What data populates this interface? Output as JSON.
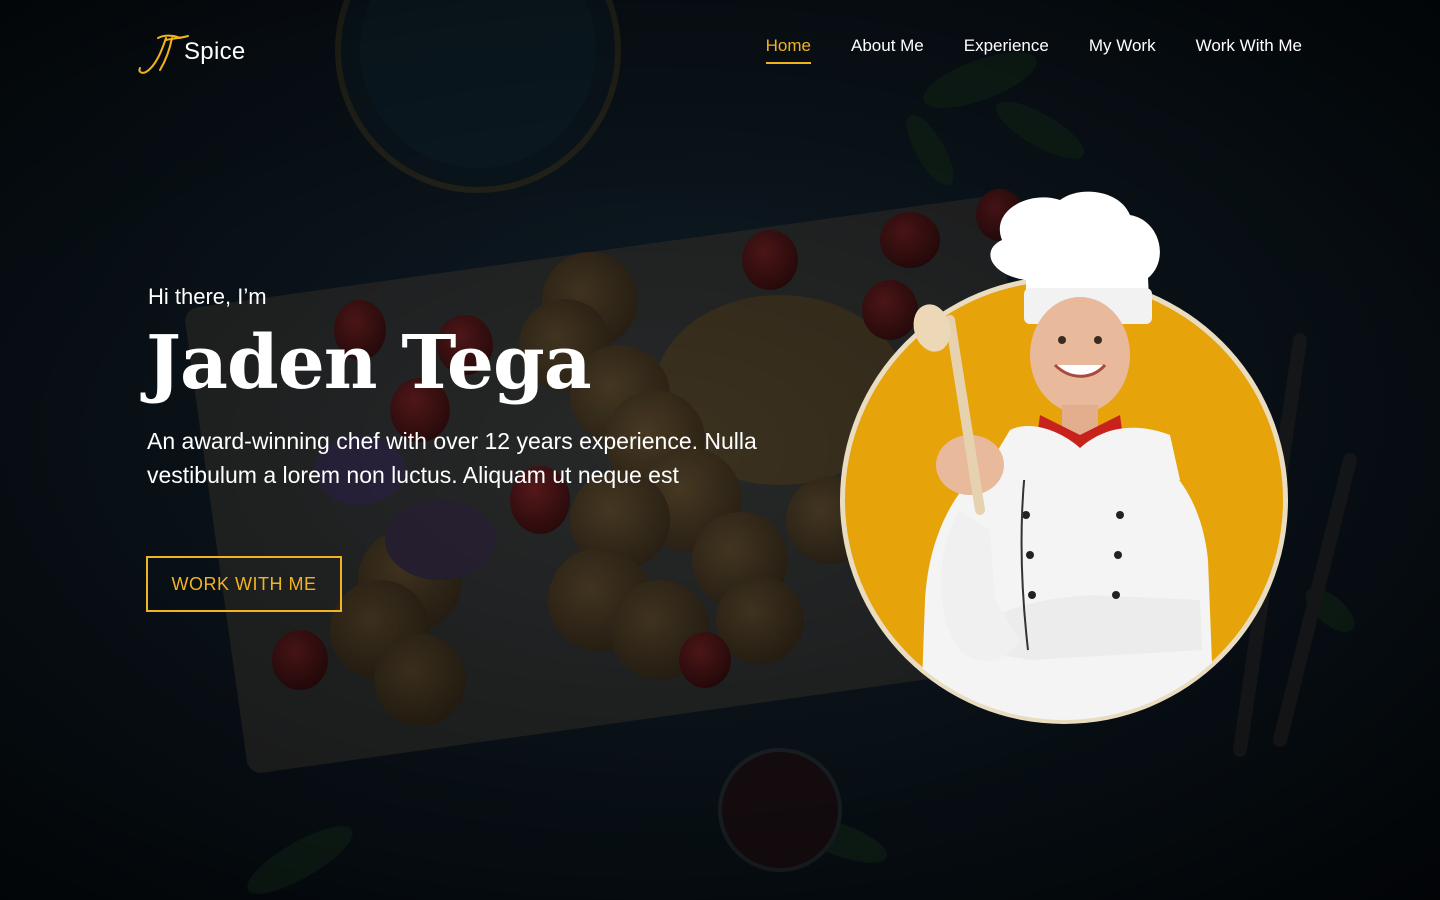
{
  "brand": {
    "mark": "JT",
    "name": "Spice",
    "accent_color": "#f2b320"
  },
  "nav": {
    "items": [
      {
        "label": "Home",
        "active": true
      },
      {
        "label": "About Me",
        "active": false
      },
      {
        "label": "Experience",
        "active": false
      },
      {
        "label": "My Work",
        "active": false
      },
      {
        "label": "Work With Me",
        "active": false
      }
    ]
  },
  "hero": {
    "greeting": "Hi there, I’m",
    "name": "Jaden Tega",
    "description": "An award-winning chef with over 12 years experience. Nulla vestibulum a lorem non luctus. Aliquam ut neque est",
    "cta_label": "WORK WITH ME",
    "portrait_circle_color": "#e6a30a"
  },
  "icons": {
    "logo": "jt-monogram-icon",
    "portrait": "chef-portrait",
    "background": "food-platter-background"
  }
}
